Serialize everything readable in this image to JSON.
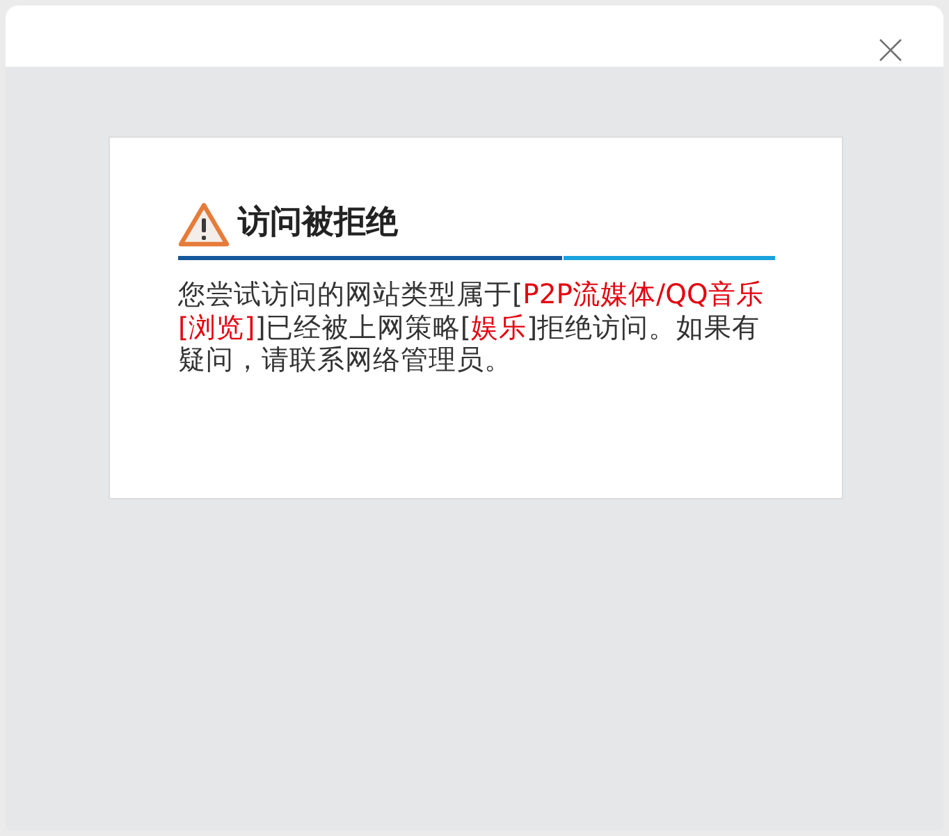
{
  "window": {
    "closable": true
  },
  "dialog": {
    "kind": "warning",
    "title": "访问被拒绝",
    "message": [
      {
        "text": "您尝试访问的网站类型属于[",
        "highlight": false
      },
      {
        "text": "P2P流媒体/QQ音乐[浏览]",
        "highlight": true
      },
      {
        "text": "]已经被上网策略[",
        "highlight": false
      },
      {
        "text": "娱乐",
        "highlight": true
      },
      {
        "text": "]拒绝访问。如果有疑问，请联系网络管理员。",
        "highlight": false
      }
    ]
  }
}
